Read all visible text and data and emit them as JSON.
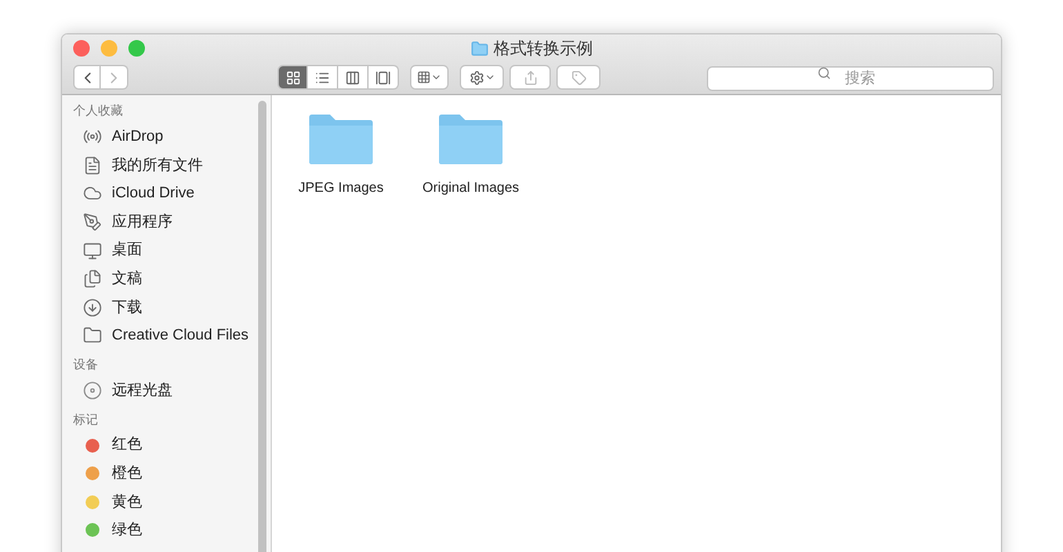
{
  "window": {
    "title": "格式转换示例"
  },
  "toolbar": {
    "views": [
      {
        "selected": true
      },
      {
        "selected": false
      },
      {
        "selected": false
      },
      {
        "selected": false
      }
    ],
    "search": {
      "placeholder": "搜索"
    }
  },
  "sidebar": {
    "sections": [
      {
        "kind": "places",
        "header": "个人收藏",
        "items": [
          {
            "label": "AirDrop"
          },
          {
            "label": "我的所有文件"
          },
          {
            "label": "iCloud Drive"
          },
          {
            "label": "应用程序"
          },
          {
            "label": "桌面"
          },
          {
            "label": "文稿"
          },
          {
            "label": "下载"
          },
          {
            "label": "Creative Cloud Files"
          }
        ]
      },
      {
        "kind": "devices",
        "header": "设备",
        "items": [
          {
            "label": "远程光盘"
          }
        ]
      },
      {
        "kind": "tags",
        "header": "标记",
        "items": [
          {
            "label": "红色",
            "color": "#e8604f"
          },
          {
            "label": "橙色",
            "color": "#eea04a"
          },
          {
            "label": "黄色",
            "color": "#f2cd55"
          },
          {
            "label": "绿色",
            "color": "#6cc355"
          }
        ]
      }
    ]
  },
  "files": [
    {
      "name": "JPEG Images"
    },
    {
      "name": "Original Images"
    }
  ]
}
